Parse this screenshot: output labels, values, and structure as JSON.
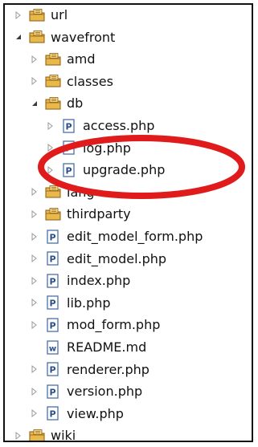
{
  "colors": {
    "folder_fill": "#e8b84a",
    "folder_edge": "#8a5a10",
    "php_file_border": "#4a6fa8",
    "php_letter": "#2b4f8a",
    "md_letter": "#2b4f8a",
    "arrow_collapsed": "#9a9a9a",
    "arrow_expanded": "#3a3a3a",
    "annotation_ellipse": "#e01b1b",
    "text": "#111111"
  },
  "tree": {
    "items": [
      {
        "label": "url",
        "type": "folder",
        "toggle": "collapsed",
        "depth": 0,
        "icon": "package-folder-icon"
      },
      {
        "label": "wavefront",
        "type": "folder",
        "toggle": "expanded",
        "depth": 0,
        "icon": "package-folder-icon"
      },
      {
        "label": "amd",
        "type": "folder",
        "toggle": "collapsed",
        "depth": 1,
        "icon": "package-folder-icon"
      },
      {
        "label": "classes",
        "type": "folder",
        "toggle": "collapsed",
        "depth": 1,
        "icon": "package-folder-icon"
      },
      {
        "label": "db",
        "type": "folder",
        "toggle": "expanded",
        "depth": 1,
        "icon": "package-folder-icon"
      },
      {
        "label": "access.php",
        "type": "php",
        "toggle": "collapsed",
        "depth": 2,
        "icon": "php-file-icon"
      },
      {
        "label": "log.php",
        "type": "php",
        "toggle": "collapsed",
        "depth": 2,
        "icon": "php-file-icon"
      },
      {
        "label": "upgrade.php",
        "type": "php",
        "toggle": "collapsed",
        "depth": 2,
        "icon": "php-file-icon"
      },
      {
        "label": "lang",
        "type": "folder",
        "toggle": "collapsed",
        "depth": 1,
        "icon": "package-folder-icon"
      },
      {
        "label": "thirdparty",
        "type": "folder",
        "toggle": "collapsed",
        "depth": 1,
        "icon": "package-folder-icon"
      },
      {
        "label": "edit_model_form.php",
        "type": "php",
        "toggle": "collapsed",
        "depth": 1,
        "icon": "php-file-icon"
      },
      {
        "label": "edit_model.php",
        "type": "php",
        "toggle": "collapsed",
        "depth": 1,
        "icon": "php-file-icon"
      },
      {
        "label": "index.php",
        "type": "php",
        "toggle": "collapsed",
        "depth": 1,
        "icon": "php-file-icon"
      },
      {
        "label": "lib.php",
        "type": "php",
        "toggle": "collapsed",
        "depth": 1,
        "icon": "php-file-icon"
      },
      {
        "label": "mod_form.php",
        "type": "php",
        "toggle": "collapsed",
        "depth": 1,
        "icon": "php-file-icon"
      },
      {
        "label": "README.md",
        "type": "md",
        "toggle": "none",
        "depth": 1,
        "icon": "markdown-file-icon"
      },
      {
        "label": "renderer.php",
        "type": "php",
        "toggle": "collapsed",
        "depth": 1,
        "icon": "php-file-icon"
      },
      {
        "label": "version.php",
        "type": "php",
        "toggle": "collapsed",
        "depth": 1,
        "icon": "php-file-icon"
      },
      {
        "label": "view.php",
        "type": "php",
        "toggle": "collapsed",
        "depth": 1,
        "icon": "php-file-icon"
      },
      {
        "label": "wiki",
        "type": "folder",
        "toggle": "collapsed",
        "depth": 0,
        "icon": "package-folder-icon"
      }
    ]
  }
}
